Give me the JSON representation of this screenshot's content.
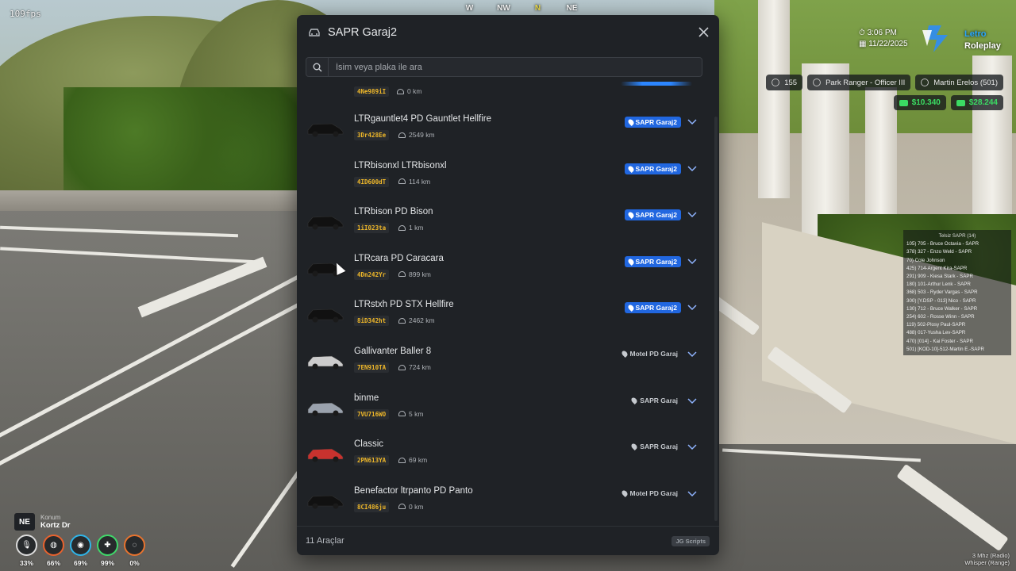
{
  "hud": {
    "fps": "109fps",
    "compass": [
      "W",
      "NW",
      "N",
      "NE"
    ],
    "compass_active": "N",
    "time": "3:06 PM",
    "date": "11/22/2025",
    "brand_line1": "Letro",
    "brand_line2": "Roleplay",
    "players": "155",
    "job": "Park Ranger - Officer III",
    "character": "Martin Erelos (501)",
    "cash": "$10.340",
    "bank": "$28.244",
    "roster_title": "Telsiz SAPR (14)",
    "roster": [
      "105) 705 - Bruce Octavia - SAPR",
      "378) 327 - Enzo Weld - SAPR",
      "70) Cole Johnson",
      "425) 714-Argent Kira-SAPR",
      "291) 909 - Kiesa Stark - SAPR",
      "180) 101-Arthur Lenk - SAPR",
      "368) 503 - Ryder Vargas - SAPR",
      "300) [Y.DSP - 013] Nico - SAPR",
      "130) 712 - Bruce Walker - SAPR",
      "254) 602 - Rosse Winn - SAPR",
      "119) 502-Plosy Paul-SAPR",
      "488) 017-Yusha Lev-SAPR",
      "470) [014] - Kai Foster - SAPR",
      "501) [KOD-10]-512-Martin E.-SAPR"
    ],
    "radio_line1": "3 Mhz (Radio)",
    "radio_line2": "Whisper (Range)",
    "direction": "NE",
    "location_label": "Konum",
    "location": "Kortz Dr",
    "stats": [
      {
        "name": "voice",
        "value": "33%",
        "color": "#dcdcdc"
      },
      {
        "name": "hunger",
        "value": "66%",
        "color": "#e8622e"
      },
      {
        "name": "thirst",
        "value": "69%",
        "color": "#2fb4e8"
      },
      {
        "name": "stamina",
        "value": "99%",
        "color": "#3fd86a"
      },
      {
        "name": "stress",
        "value": "0%",
        "color": "#e8732e"
      }
    ]
  },
  "panel": {
    "title": "SAPR Garaj2",
    "search_placeholder": "İsim veya plaka ile ara",
    "footer_count": "11 Araçlar",
    "footer_brand": "JG Scripts",
    "accent": "#2167e0",
    "plate_color": "#f1b929",
    "partial_row": {
      "plate": "4Ne989iI",
      "km": "0 km"
    },
    "vehicles": [
      {
        "name": "LTRgauntlet4 PD Gauntlet Hellfire",
        "plate": "3Dr428Ee",
        "km": "2549 km",
        "location": "SAPR Garaj2",
        "here": true
      },
      {
        "name": "LTRbisonxl LTRbisonxl",
        "plate": "4ID600dT",
        "km": "114 km",
        "location": "SAPR Garaj2",
        "here": true
      },
      {
        "name": "LTRbison PD Bison",
        "plate": "1iI023ta",
        "km": "1 km",
        "location": "SAPR Garaj2",
        "here": true
      },
      {
        "name": "LTRcara PD Caracara",
        "plate": "4Dn242Yr",
        "km": "899 km",
        "location": "SAPR Garaj2",
        "here": true
      },
      {
        "name": "LTRstxh PD STX Hellfire",
        "plate": "8iD342ht",
        "km": "2462 km",
        "location": "SAPR Garaj2",
        "here": true
      },
      {
        "name": "Gallivanter Baller 8",
        "plate": "7EN910TA",
        "km": "724 km",
        "location": "Motel PD Garaj",
        "here": false
      },
      {
        "name": "binme",
        "plate": "7VU716WO",
        "km": "5 km",
        "location": "SAPR Garaj",
        "here": false
      },
      {
        "name": "Classic",
        "plate": "2PN613YA",
        "km": "69 km",
        "location": "SAPR Garaj",
        "here": false
      },
      {
        "name": "Benefactor ltrpanto PD Panto",
        "plate": "8CI486ju",
        "km": "0 km",
        "location": "Motel PD Garaj",
        "here": false
      }
    ]
  }
}
